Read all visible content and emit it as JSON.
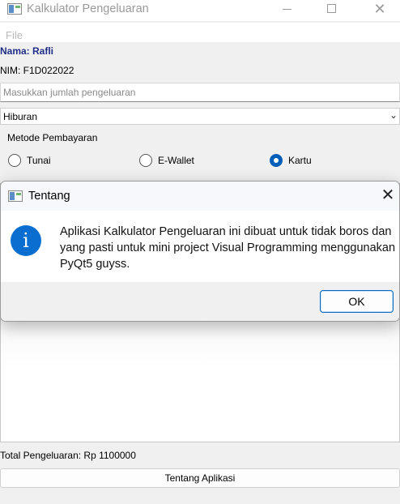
{
  "window": {
    "title": "Kalkulator Pengeluaran",
    "controls": {
      "minimize": "minimize-icon",
      "maximize": "maximize-icon",
      "close": "close-icon"
    }
  },
  "menu": {
    "file": "File"
  },
  "profile": {
    "name": "Nama: Rafli",
    "nim": "NIM: F1D022022"
  },
  "amount_input": {
    "placeholder": "Masukkan jumlah pengeluaran",
    "value": ""
  },
  "category": {
    "selected": "Hiburan"
  },
  "payment": {
    "title": "Metode Pembayaran",
    "options": [
      {
        "label": "Tunai",
        "checked": false
      },
      {
        "label": "E-Wallet",
        "checked": false
      },
      {
        "label": "Kartu",
        "checked": true
      }
    ]
  },
  "total": "Total Pengeluaran: Rp 1100000",
  "about_button": "Tentang Aplikasi",
  "dialog": {
    "title": "Tentang",
    "icon": "info-icon",
    "icon_glyph": "i",
    "message": "Aplikasi Kalkulator Pengeluaran ini dibuat untuk tidak boros dan yang pasti untuk mini project Visual Programming menggunakan PyQt5 guyss.",
    "ok": "OK"
  },
  "colors": {
    "accent": "#005fb8",
    "info_icon": "#0a6ed0",
    "name_label": "#1f2d86"
  }
}
